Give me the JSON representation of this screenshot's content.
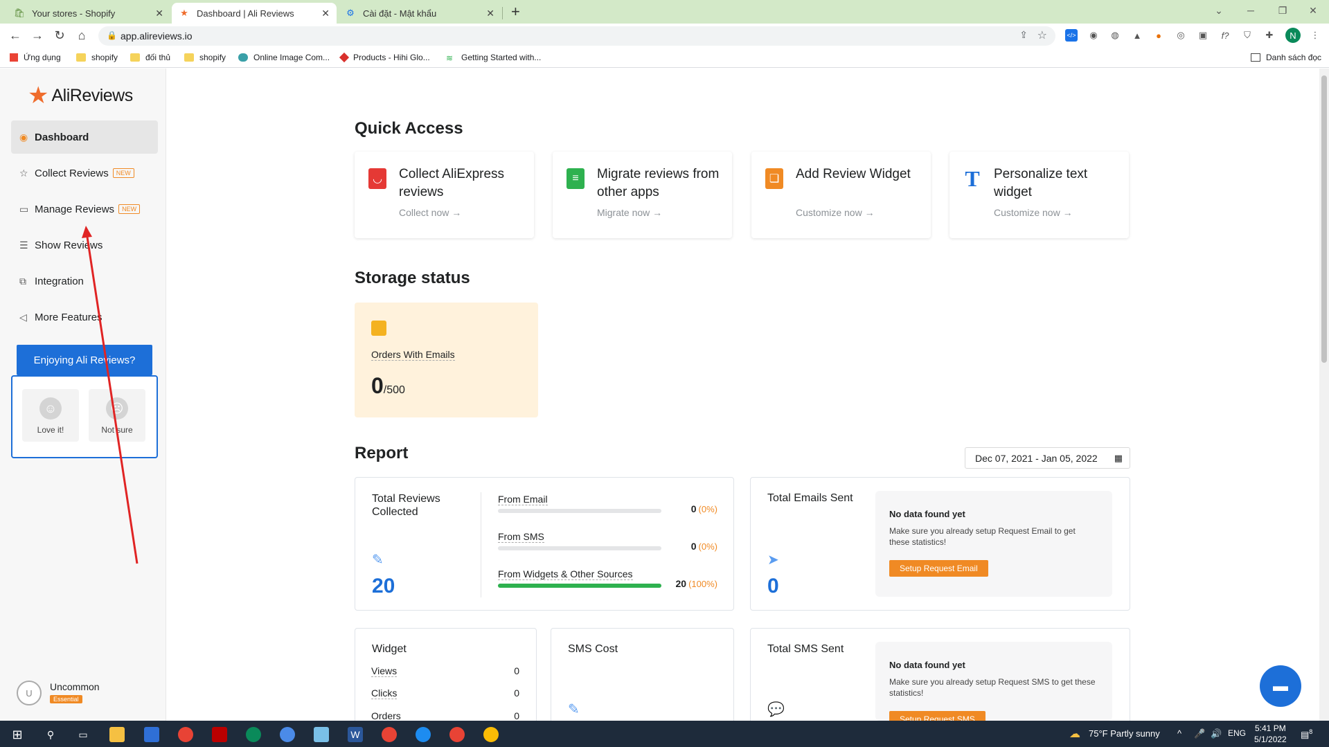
{
  "browser": {
    "tabs": [
      {
        "title": "Your stores - Shopify",
        "icon": "shopify-icon"
      },
      {
        "title": "Dashboard | Ali Reviews",
        "icon": "alireviews-icon"
      },
      {
        "title": "Cài đặt - Mật khẩu",
        "icon": "gear-icon"
      }
    ],
    "new_tab": "+",
    "url": "app.alireviews.io",
    "profile_initial": "N",
    "bookmarks": [
      "Ứng dụng",
      "shopify",
      "đối thủ",
      "shopify",
      "Online Image Com...",
      "Products - Hihi Glo...",
      "Getting Started with..."
    ],
    "reading_list": "Danh sách đọc"
  },
  "sidebar": {
    "logo_text": "AliReviews",
    "items": [
      {
        "label": "Dashboard",
        "icon": "dashboard-icon",
        "active": true
      },
      {
        "label": "Collect Reviews",
        "icon": "star-icon",
        "badge": "NEW"
      },
      {
        "label": "Manage Reviews",
        "icon": "folder-icon",
        "badge": "NEW"
      },
      {
        "label": "Show Reviews",
        "icon": "layout-icon"
      },
      {
        "label": "Integration",
        "icon": "puzzle-icon"
      },
      {
        "label": "More Features",
        "icon": "megaphone-icon"
      }
    ],
    "feedback": {
      "title": "Enjoying Ali Reviews?",
      "options": [
        "Love it!",
        "Not sure"
      ]
    },
    "user": {
      "initial": "U",
      "name": "Uncommon",
      "plan": "Essential"
    }
  },
  "quick_access": {
    "title": "Quick Access",
    "cards": [
      {
        "title": "Collect AliExpress reviews",
        "link": "Collect now",
        "color": "#e53935"
      },
      {
        "title": "Migrate reviews from other apps",
        "link": "Migrate now",
        "color": "#2eb14f"
      },
      {
        "title": "Add Review Widget",
        "link": "Customize now",
        "color": "#f08a24"
      },
      {
        "title": "Personalize text widget",
        "link": "Customize now",
        "color": "#1d6fd8"
      }
    ],
    "link_arrow": "→"
  },
  "storage": {
    "title": "Storage status",
    "label": "Orders With Emails",
    "value": "0",
    "limit": "/500"
  },
  "report": {
    "title": "Report",
    "date_range": "Dec 07, 2021 - Jan 05, 2022",
    "total_reviews": {
      "title": "Total Reviews Collected",
      "value": "20",
      "sources": [
        {
          "label": "From Email",
          "value": "0",
          "pct": "(0%)",
          "fraction": 0
        },
        {
          "label": "From SMS",
          "value": "0",
          "pct": "(0%)",
          "fraction": 0
        },
        {
          "label": "From Widgets & Other Sources",
          "value": "20",
          "pct": "(100%)",
          "fraction": 1
        }
      ]
    },
    "emails": {
      "title": "Total Emails Sent",
      "value": "0",
      "nodata_title": "No data found yet",
      "nodata_desc": "Make sure you already setup Request Email to get these statistics!",
      "button": "Setup Request Email"
    },
    "widget": {
      "title": "Widget",
      "rows": [
        {
          "label": "Views",
          "value": "0"
        },
        {
          "label": "Clicks",
          "value": "0"
        },
        {
          "label": "Orders",
          "value": "0"
        }
      ]
    },
    "sms_cost": {
      "title": "SMS Cost"
    },
    "sms": {
      "title": "Total SMS Sent",
      "nodata_title": "No data found yet",
      "nodata_desc": "Make sure you already setup Request SMS to get these statistics!",
      "button": "Setup Request SMS"
    }
  },
  "taskbar": {
    "weather": "75°F  Partly sunny",
    "lang": "ENG",
    "time": "5:41 PM",
    "date": "5/1/2022",
    "notif_count": "8"
  }
}
